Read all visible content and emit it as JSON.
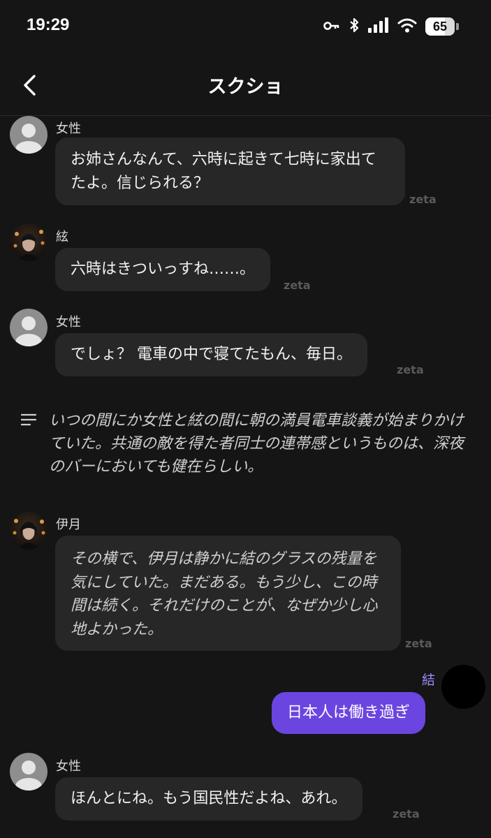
{
  "status": {
    "time": "19:29",
    "battery": "65"
  },
  "header": {
    "title": "スクショ"
  },
  "messages": [
    {
      "name": "女性",
      "text": "お姉さんなんて、六時に起きて七時に家出てたよ。信じられる？",
      "watermark": "zeta"
    },
    {
      "name": "絃",
      "text": "六時はきついっすね……。",
      "watermark": "zeta"
    },
    {
      "name": "女性",
      "text": "でしょ？ 電車の中で寝てたもん、毎日。",
      "watermark": "zeta"
    },
    {
      "name": "伊月",
      "text": "その横で、伊月は静かに結のグラスの残量を気にしていた。まだある。もう少し、この時間は続く。それだけのことが、なぜか少し心地よかった。",
      "watermark": "zeta"
    },
    {
      "name": "女性",
      "text": "ほんとにね。もう国民性だよね、あれ。",
      "watermark": "zeta"
    }
  ],
  "narration": {
    "text": "いつの間にか女性と絃の間に朝の満員電車談義が始まりかけていた。共通の敵を得た者同士の連帯感というものは、深夜のバーにおいても健在らしい。"
  },
  "user_message": {
    "name": "結",
    "text": "日本人は働き過ぎ"
  },
  "colors": {
    "background": "#151515",
    "bubble": "#272727",
    "user_bubble": "#6b45e0",
    "user_name": "#9b8cff"
  },
  "icons": [
    "key-icon",
    "bluetooth-icon",
    "signal-icon",
    "wifi-icon",
    "battery-icon",
    "back-chevron-icon",
    "narration-lines-icon"
  ]
}
